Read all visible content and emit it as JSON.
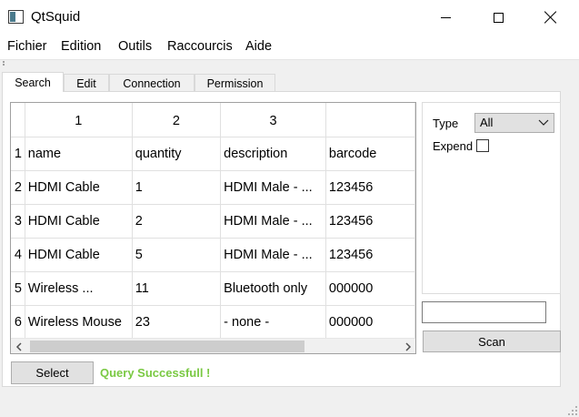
{
  "window": {
    "title": "QtSquid",
    "minimize_icon": "minimize-icon",
    "maximize_icon": "maximize-icon",
    "close_icon": "close-icon"
  },
  "menu": {
    "items": [
      "Fichier",
      "Edition",
      "Outils",
      "Raccourcis",
      "Aide"
    ]
  },
  "tabs": {
    "items": [
      "Search",
      "Edit",
      "Connection",
      "Permission"
    ],
    "active": "Search"
  },
  "table": {
    "column_headers": [
      "1",
      "2",
      "3"
    ],
    "row_headers": [
      "1",
      "2",
      "3",
      "4",
      "5",
      "6"
    ],
    "rows": [
      [
        "name",
        "quantity",
        "description",
        "barcode"
      ],
      [
        "HDMI Cable",
        "1",
        "HDMI Male - ...",
        "123456"
      ],
      [
        "HDMI Cable",
        "2",
        "HDMI Male - ...",
        "123456"
      ],
      [
        "HDMI Cable",
        "5",
        "HDMI Male - ...",
        "123456"
      ],
      [
        "Wireless ...",
        "11",
        "Bluetooth only",
        "000000"
      ],
      [
        "Wireless Mouse",
        "23",
        "- none -",
        "000000"
      ]
    ],
    "scroll_left_icon": "chevron-left-icon",
    "scroll_right_icon": "chevron-right-icon"
  },
  "filter": {
    "type_label": "Type",
    "type_value": "All",
    "expend_label": "Expend",
    "expend_checked": false
  },
  "scan": {
    "input_value": "",
    "button_label": "Scan"
  },
  "footer": {
    "select_label": "Select",
    "status_text": "Query Successfull !",
    "status_color": "#7ac943"
  }
}
